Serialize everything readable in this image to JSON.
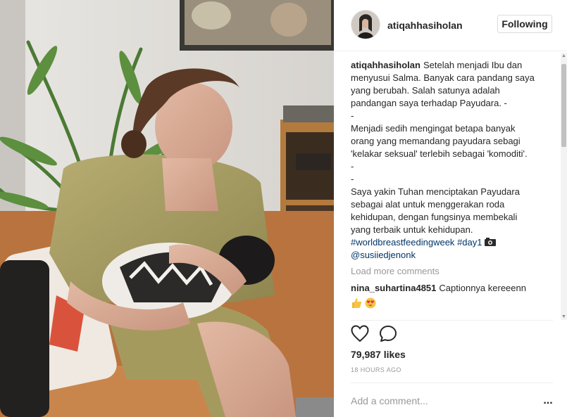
{
  "post": {
    "username": "atiqahhasiholan",
    "follow_label": "Following",
    "caption": {
      "username": "atiqahhasiholan",
      "line1": "Setelah menjadi Ibu dan",
      "lines": [
        "menyusui Salma. Banyak cara pandang saya",
        "yang berubah. Salah satunya adalah",
        "pandangan saya terhadap Payudara. -",
        "-",
        "Menjadi sedih mengingat betapa banyak",
        "orang yang memandang payudara sebagi",
        "'kelakar seksual' terlebih sebagai 'komoditi'.",
        "-",
        "-",
        "Saya yakin Tuhan menciptakan Payudara",
        "sebagai alat untuk menggerakan roda",
        "kehidupan, dengan fungsinya membekali",
        "yang terbaik untuk kehidupan."
      ],
      "hashtag1": "#worldbreastfeedingweek",
      "hashtag2": "#day1",
      "camera_icon": "camera-emoji",
      "mention": "@susiiedjenonk"
    },
    "load_more": "Load more comments",
    "comment": {
      "username": "nina_suhartina4851",
      "text": "Captionnya kereeenn",
      "emojis": [
        "thumbs-up-emoji",
        "heart-eyes-emoji"
      ]
    },
    "likes": "79,987 likes",
    "time": "18 HOURS AGO",
    "add_comment_placeholder": "Add a comment...",
    "more_options": "..."
  },
  "colors": {
    "text": "#262626",
    "muted": "#999999",
    "link": "#003569",
    "border": "#dbdbdb"
  }
}
